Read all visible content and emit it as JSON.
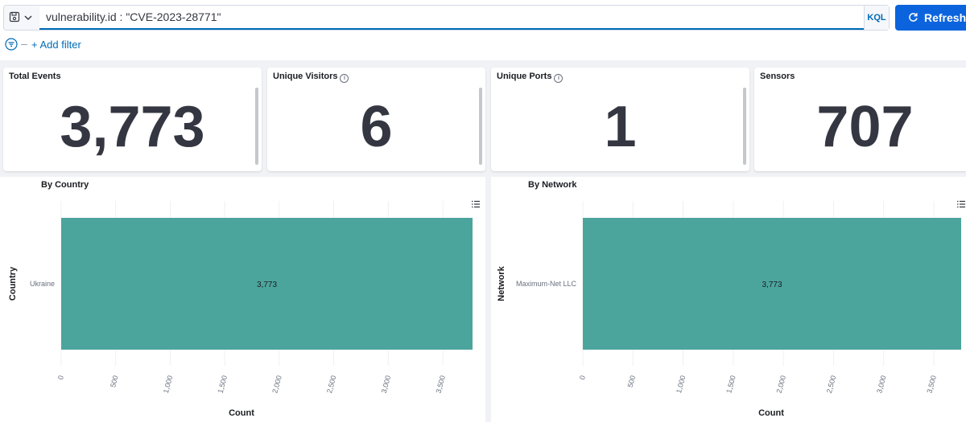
{
  "query_bar": {
    "query": "vulnerability.id : \"CVE-2023-28771\"",
    "language": "KQL",
    "refresh_label": "Refresh",
    "add_filter_label": "+ Add filter"
  },
  "metrics": [
    {
      "title": "Total Events",
      "value": "3,773",
      "info": false
    },
    {
      "title": "Unique Visitors",
      "value": "6",
      "info": true
    },
    {
      "title": "Unique Ports",
      "value": "1",
      "info": true
    },
    {
      "title": "Sensors",
      "value": "707",
      "info": false
    }
  ],
  "colors": {
    "accent": "#0b64dd",
    "bar": "#4ca59d",
    "link": "#006bb8"
  },
  "chart_data": [
    {
      "type": "bar",
      "orientation": "horizontal",
      "title": "By Country",
      "categories": [
        "Ukraine"
      ],
      "values": [
        3773
      ],
      "data_labels": [
        "3,773"
      ],
      "xlabel": "Count",
      "ylabel": "Country",
      "xlim": [
        0,
        3773
      ],
      "ticks": [
        0,
        500,
        1000,
        1500,
        2000,
        2500,
        3000,
        3500
      ],
      "tick_labels": [
        "0",
        "500",
        "1,000",
        "1,500",
        "2,000",
        "2,500",
        "3,000",
        "3,500"
      ],
      "grid": true
    },
    {
      "type": "bar",
      "orientation": "horizontal",
      "title": "By Network",
      "categories": [
        "Maximum-Net LLC"
      ],
      "values": [
        3773
      ],
      "data_labels": [
        "3,773"
      ],
      "xlabel": "Count",
      "ylabel": "Network",
      "xlim": [
        0,
        3773
      ],
      "ticks": [
        0,
        500,
        1000,
        1500,
        2000,
        2500,
        3000,
        3500
      ],
      "tick_labels": [
        "0",
        "500",
        "1,000",
        "1,500",
        "2,000",
        "2,500",
        "3,000",
        "3,500"
      ],
      "grid": true
    }
  ]
}
